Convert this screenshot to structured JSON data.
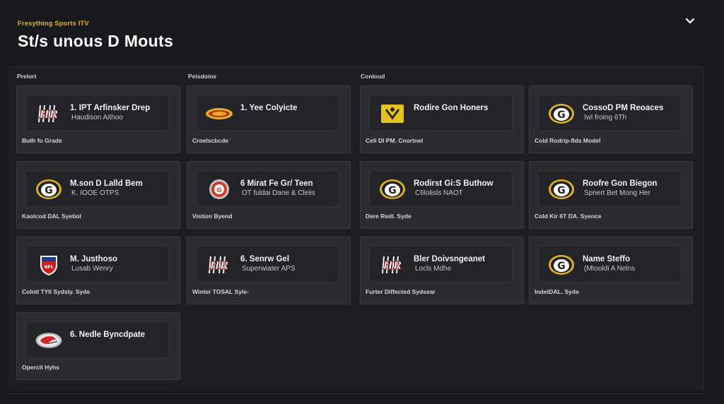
{
  "header": {
    "brand": "Fresything Sports ITV",
    "title": "St/s unous D Mouts"
  },
  "columns": [
    "Prelort",
    "Peisdoins",
    "Conloud"
  ],
  "colors": {
    "accent": "#e3b21c",
    "background": "#18191c",
    "card": "#2b2c30"
  },
  "cards": [
    {
      "logo": "hr-logo",
      "name": "1. IPT Arfinsker Drep",
      "sub": "Haudison Aithoo",
      "footer": "Buth fo Grade"
    },
    {
      "logo": "yellow-oval-logo",
      "name": "1. Yee Colyicte",
      "sub": "",
      "footer": "Croelscbcde"
    },
    {
      "logo": "yellow-box-logo",
      "name": "Rodire Gon Honers",
      "sub": "",
      "footer": "Celi Dl PM. Cnortnel"
    },
    {
      "logo": "g-logo",
      "name": "CossoD PM Reoaces",
      "sub": "Iwl froing 6Th",
      "footer": "Cold Rodrip-flds Model"
    },
    {
      "logo": "g-logo",
      "name": "M.son D Lalld Bem",
      "sub": "K. IOOE OTPS",
      "footer": "Kaotcod DAL Syetiol"
    },
    {
      "logo": "red-circle-logo",
      "name": "6 Mirat Fe Gr/ Teen",
      "sub": "OT fuldai Dane & Cleiis",
      "footer": "Vistion Byend"
    },
    {
      "logo": "g-logo",
      "name": "Rodirst Gi:S Buthow",
      "sub": "C6lolisls NAOT",
      "footer": "Dere Redl. Syde"
    },
    {
      "logo": "g-logo",
      "name": "Roofre Gon Biegon",
      "sub": "Spnert Bet Mong Her",
      "footer": "Cold Kir 6T DA. Syence"
    },
    {
      "logo": "shield-logo",
      "name": "M. Justhoso",
      "sub": "Lusab Wenry",
      "footer": "Colntl TYII Sydsly. Syde"
    },
    {
      "logo": "hr-logo",
      "name": "6. Senrw Gel",
      "sub": "Superwiater APS",
      "footer": "Winter TOSAL Syle-"
    },
    {
      "logo": "hr-logo",
      "name": "Bler Doivsngeanet",
      "sub": "Locls Mdhe",
      "footer": "Furter Diffected Sydsear"
    },
    {
      "logo": "g-logo",
      "name": "Name Steffo",
      "sub": "(Mtooldi A Nelns",
      "footer": "IndetDAL. Syde"
    },
    {
      "logo": "red-helmet-logo",
      "name": "6. Nedle Byncdpate",
      "sub": "",
      "footer": "Opercit Hyhs"
    }
  ]
}
